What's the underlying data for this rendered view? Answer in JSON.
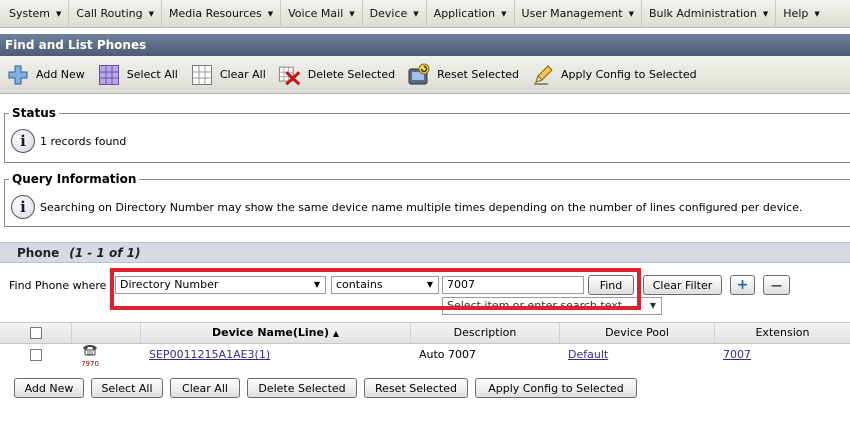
{
  "menu": [
    {
      "label": "System"
    },
    {
      "label": "Call Routing"
    },
    {
      "label": "Media Resources"
    },
    {
      "label": "Voice Mail"
    },
    {
      "label": "Device"
    },
    {
      "label": "Application"
    },
    {
      "label": "User Management"
    },
    {
      "label": "Bulk Administration"
    },
    {
      "label": "Help"
    }
  ],
  "page": {
    "title": "Find and List Phones"
  },
  "toolbar": {
    "add_new": "Add New",
    "select_all": "Select All",
    "clear_all": "Clear All",
    "delete_selected": "Delete Selected",
    "reset_selected": "Reset Selected",
    "apply_config": "Apply Config to Selected"
  },
  "status": {
    "legend": "Status",
    "message": "1 records found"
  },
  "query": {
    "legend": "Query Information",
    "message": "Searching on Directory Number may show the same device name multiple times depending on the number of lines configured per device."
  },
  "phone": {
    "header": "Phone",
    "range": "(1 - 1 of 1)",
    "find_label": "Find Phone where",
    "field_select": "Directory Number",
    "operator_select": "contains",
    "search_value": "7007",
    "find_button": "Find",
    "clear_filter_button": "Clear Filter",
    "plus_symbol": "+",
    "minus_symbol": "—",
    "secondary_select": "Select item or enter search text"
  },
  "table": {
    "columns": {
      "device_name": "Device Name(Line)",
      "sort_indicator": "▲",
      "description": "Description",
      "device_pool": "Device Pool",
      "extension": "Extension"
    },
    "rows": [
      {
        "model": "7970",
        "device_name": "SEP0011215A1AE3(1)",
        "description": "Auto 7007",
        "device_pool": "Default",
        "extension": "7007"
      }
    ]
  },
  "bottom": {
    "add_new": "Add New",
    "select_all": "Select All",
    "clear_all": "Clear All",
    "delete_selected": "Delete Selected",
    "reset_selected": "Reset Selected",
    "apply_config": "Apply Config to Selected"
  },
  "colors": {
    "title_bar": "#5a6b84",
    "highlight_box": "#e0202a",
    "link": "#3a2a8a"
  }
}
